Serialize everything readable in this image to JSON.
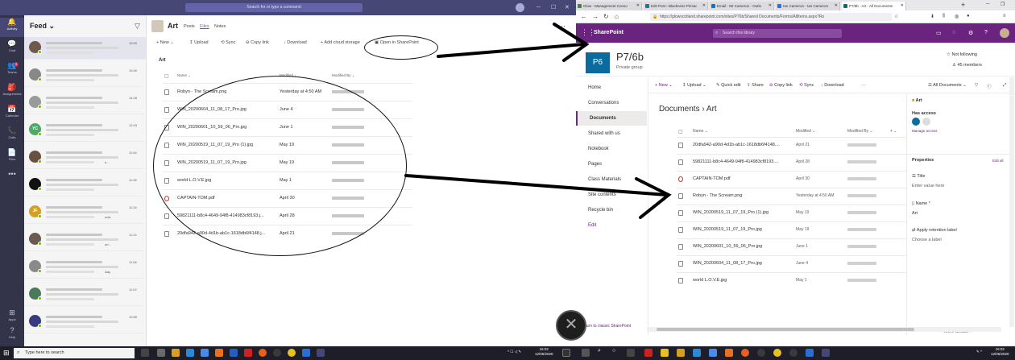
{
  "teams": {
    "search_placeholder": "Search for or type a command",
    "rail": [
      {
        "icon": "bell-icon",
        "glyph": "🔔",
        "label": "Activity",
        "badge": ""
      },
      {
        "icon": "chat-icon",
        "glyph": "💬",
        "label": "Chat",
        "badge": ""
      },
      {
        "icon": "teams-icon",
        "glyph": "👥",
        "label": "Teams",
        "badge": "3"
      },
      {
        "icon": "assignments-icon",
        "glyph": "🎒",
        "label": "Assignments",
        "badge": ""
      },
      {
        "icon": "calendar-icon",
        "glyph": "📅",
        "label": "Calendar",
        "badge": ""
      },
      {
        "icon": "calls-icon",
        "glyph": "📞",
        "label": "Calls",
        "badge": ""
      },
      {
        "icon": "files-icon",
        "glyph": "📄",
        "label": "Files",
        "badge": ""
      },
      {
        "icon": "more-icon",
        "glyph": "•••",
        "label": "",
        "badge": ""
      }
    ],
    "rail_bottom": [
      {
        "icon": "apps-icon",
        "glyph": "⊞",
        "label": "Apps"
      },
      {
        "icon": "help-icon",
        "glyph": "?",
        "label": "Help"
      }
    ],
    "feed": {
      "title": "Feed",
      "items": [
        {
          "initials": "",
          "color": "#6d5a4c",
          "time": "15:59",
          "snippet": ""
        },
        {
          "initials": "",
          "color": "#888888",
          "time": "15:49",
          "snippet": ""
        },
        {
          "initials": "",
          "color": "#9a9a9a",
          "time": "14:28",
          "snippet": ""
        },
        {
          "initials": "YC",
          "color": "#4ea86a",
          "time": "12:43",
          "snippet": ""
        },
        {
          "initials": "",
          "color": "#6a5040",
          "time": "11:54",
          "snippet": "e..."
        },
        {
          "initials": "",
          "color": "#111111",
          "time": "11:35",
          "snippet": ""
        },
        {
          "initials": "JF",
          "color": "#d4a020",
          "time": "11:34",
          "snippet": "ools"
        },
        {
          "initials": "",
          "color": "#6a5a50",
          "time": "11:22",
          "snippet": "on'..."
        },
        {
          "initials": "",
          "color": "#8a8a8a",
          "time": "11:06",
          "snippet": "Day"
        },
        {
          "initials": "",
          "color": "#4a7a5a",
          "time": "11:02",
          "snippet": ""
        },
        {
          "initials": "",
          "color": "#3a3a80",
          "time": "10:55",
          "snippet": ""
        }
      ]
    },
    "channel": {
      "name": "Art",
      "tabs": [
        "Posts",
        "Files",
        "Notes"
      ],
      "commands": [
        "+ New",
        "Upload",
        "Sync",
        "Copy link",
        "Download",
        "+ Add cloud storage",
        "Open in SharePoint"
      ],
      "breadcrumb": "Art",
      "columns": [
        "Name",
        "Modified",
        "Modified By"
      ],
      "files": [
        {
          "name": "Robyn - The Scream.png",
          "modified": "Yesterday at 4:50 AM",
          "type": "img"
        },
        {
          "name": "WIN_20200604_11_08_17_Pro.jpg",
          "modified": "June 4",
          "type": "img"
        },
        {
          "name": "WIN_20200601_10_59_06_Pro.jpg",
          "modified": "June 1",
          "type": "img"
        },
        {
          "name": "WIN_20200519_11_07_19_Pro (1).jpg",
          "modified": "May 19",
          "type": "img"
        },
        {
          "name": "WIN_20200519_11_07_19_Pro.jpg",
          "modified": "May 19",
          "type": "img"
        },
        {
          "name": "world L.O.V.E.jpg",
          "modified": "May 1",
          "type": "img"
        },
        {
          "name": "CAPTAIN-TOM.pdf",
          "modified": "April 30",
          "type": "pdf"
        },
        {
          "name": "59821111-b8c4-4649-94f8-414983cf8193.j...",
          "modified": "April 28",
          "type": "img"
        },
        {
          "name": "20dfa942-a90d-4d1b-ab1c-1618db6f4148.j...",
          "modified": "April 21",
          "type": "img"
        }
      ]
    }
  },
  "browser": {
    "tabs": [
      {
        "label": "Glow - Management Conso",
        "color": "#3a8a3a",
        "active": false
      },
      {
        "label": "Edit Post ‹ Blackness Primar",
        "color": "#21759b",
        "active": false
      },
      {
        "label": "Email - Mr Cameron - Outlo",
        "color": "#0078d4",
        "active": false
      },
      {
        "label": "Ian Cameron - Ian Cameron",
        "color": "#1877f2",
        "active": false
      },
      {
        "label": "P7/6b - Art - All Documents",
        "color": "#036c70",
        "active": true
      }
    ],
    "tooltip": "P7/6b - Art - All Documents",
    "url": "https://glowscotland.sharepoint.com/sites/P76b/Shared Documents/Forms/AllItems.aspx?Ro",
    "sharepoint": {
      "brand": "SharePoint",
      "search_placeholder": "Search this library",
      "site_logo": "P6",
      "site_title": "P7/6b",
      "site_subtitle": "Private group",
      "follow": "Not following",
      "members": "45 members",
      "leftnav": [
        "Home",
        "Conversations",
        "Documents",
        "Shared with us",
        "Notebook",
        "Pages",
        "Class Materials",
        "Site contents",
        "Recycle bin",
        "Edit"
      ],
      "classic_link": "Return to classic SharePoint",
      "commands": [
        "+ New",
        "Upload",
        "Quick edit",
        "Share",
        "Copy link",
        "Sync",
        "Download",
        "···"
      ],
      "view": "All Documents",
      "breadcrumb": "Documents  ›  Art",
      "columns": [
        "Name",
        "Modified",
        "Modified By"
      ],
      "files": [
        {
          "name": "20dfa942-a90d-4d1b-ab1c-1618db6f4148....",
          "modified": "April 21",
          "type": "img"
        },
        {
          "name": "59821111-b8c4-4649-94f8-414983cf8193....",
          "modified": "April 28",
          "type": "img"
        },
        {
          "name": "CAPTAIN-TOM.pdf",
          "modified": "April 30",
          "type": "pdf"
        },
        {
          "name": "Robyn - The Scream.png",
          "modified": "Yesterday at 4:50 AM",
          "type": "img"
        },
        {
          "name": "WIN_20200519_11_07_19_Pro (1).jpg",
          "modified": "May 19",
          "type": "img"
        },
        {
          "name": "WIN_20200519_11_07_19_Pro.jpg",
          "modified": "May 19",
          "type": "img"
        },
        {
          "name": "WIN_20200601_10_59_06_Pro.jpg",
          "modified": "June 1",
          "type": "img"
        },
        {
          "name": "WIN_20200604_11_08_17_Pro.jpg",
          "modified": "June 4",
          "type": "img"
        },
        {
          "name": "world L.O.V.E.jpg",
          "modified": "May 1",
          "type": "img"
        }
      ],
      "pane": {
        "folder": "Art",
        "has_access": "Has access",
        "manage_access": "Manage access",
        "properties": "Properties",
        "edit_all": "Edit all",
        "title_label": "Title",
        "title_placeholder": "Enter value here",
        "name_label": "Name",
        "name_value": "Art",
        "retention": "Apply retention label",
        "retention_value": "Choose a label",
        "more_details": "More details"
      }
    }
  },
  "taskbar": {
    "search_placeholder": "Type here to search",
    "time": "16:02",
    "date": "12/06/2020"
  },
  "colors": {
    "teams_purple": "#464775",
    "sharepoint_purple": "#6a2480",
    "taskbar": "#1e1e28"
  }
}
